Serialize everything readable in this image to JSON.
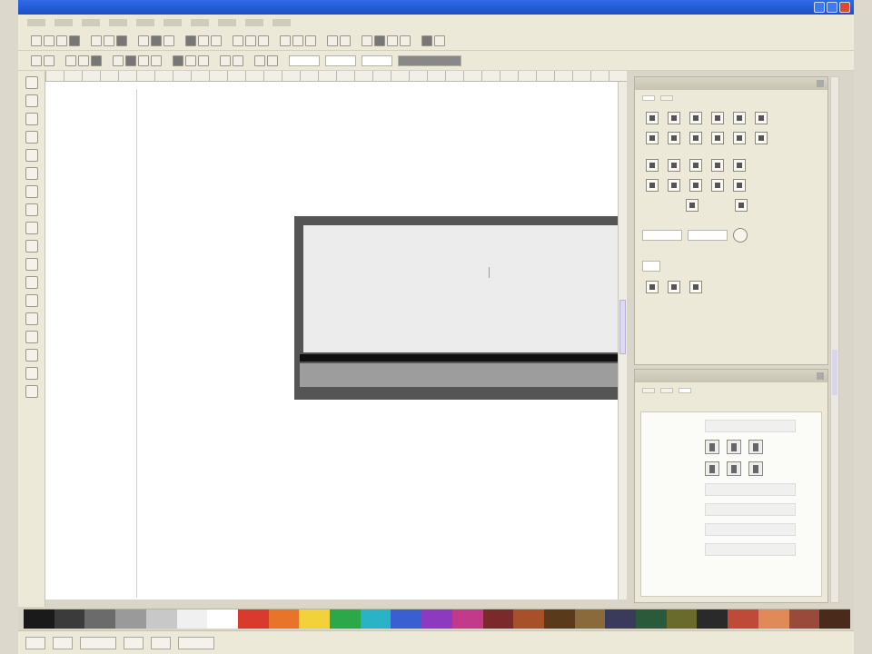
{
  "window": {
    "title": "",
    "menus": [
      "",
      "",
      "",
      "",
      "",
      "",
      "",
      "",
      "",
      ""
    ]
  },
  "toolbars": {
    "top_groups": [
      4,
      3,
      3,
      3,
      3,
      3,
      2,
      4,
      2
    ],
    "second_groups": [
      2,
      3,
      4,
      3,
      2,
      2
    ]
  },
  "toolbox": {
    "tools": [
      "selector-icon",
      "node-icon",
      "zoom-icon",
      "rectangle-icon",
      "circle-icon",
      "star-icon",
      "spiral-icon",
      "pencil-icon",
      "pen-icon",
      "calligraphy-icon",
      "text-icon",
      "gradient-icon",
      "dropper-icon",
      "connector-icon",
      "paint-bucket-icon",
      "tweak-icon",
      "spray-icon",
      "eraser-icon"
    ]
  },
  "canvas": {
    "background": "#ffffff",
    "banner_frame_color": "#555555",
    "banner_fill_color": "#ececec",
    "bar_color": "#111111",
    "strip_color": "#9d9d9d"
  },
  "align_panel": {
    "title": "",
    "tabs": [
      "",
      ""
    ],
    "section_labels": [
      "",
      "",
      "",
      ""
    ]
  },
  "text_panel": {
    "title": "",
    "tabs": [
      "",
      "",
      ""
    ]
  },
  "palette": {
    "colors": [
      "#1a1a1a",
      "#3b3b3b",
      "#6b6b6b",
      "#9a9a9a",
      "#c8c8c8",
      "#f0f0f0",
      "#ffffff",
      "#d83a2e",
      "#e8742a",
      "#f2d23a",
      "#2aa84a",
      "#2ab3c6",
      "#3a5fd0",
      "#8c3ac0",
      "#c43a8a",
      "#7a2a2a",
      "#a8502a",
      "#5a3a1a",
      "#8a6a3a",
      "#3a3a5a",
      "#2a5a3a",
      "#6a6a2a",
      "#2a2a2a",
      "#c04a3a",
      "#e08a5a",
      "#9a4a3a",
      "#4a2a1a"
    ]
  },
  "status": {
    "text": ""
  }
}
